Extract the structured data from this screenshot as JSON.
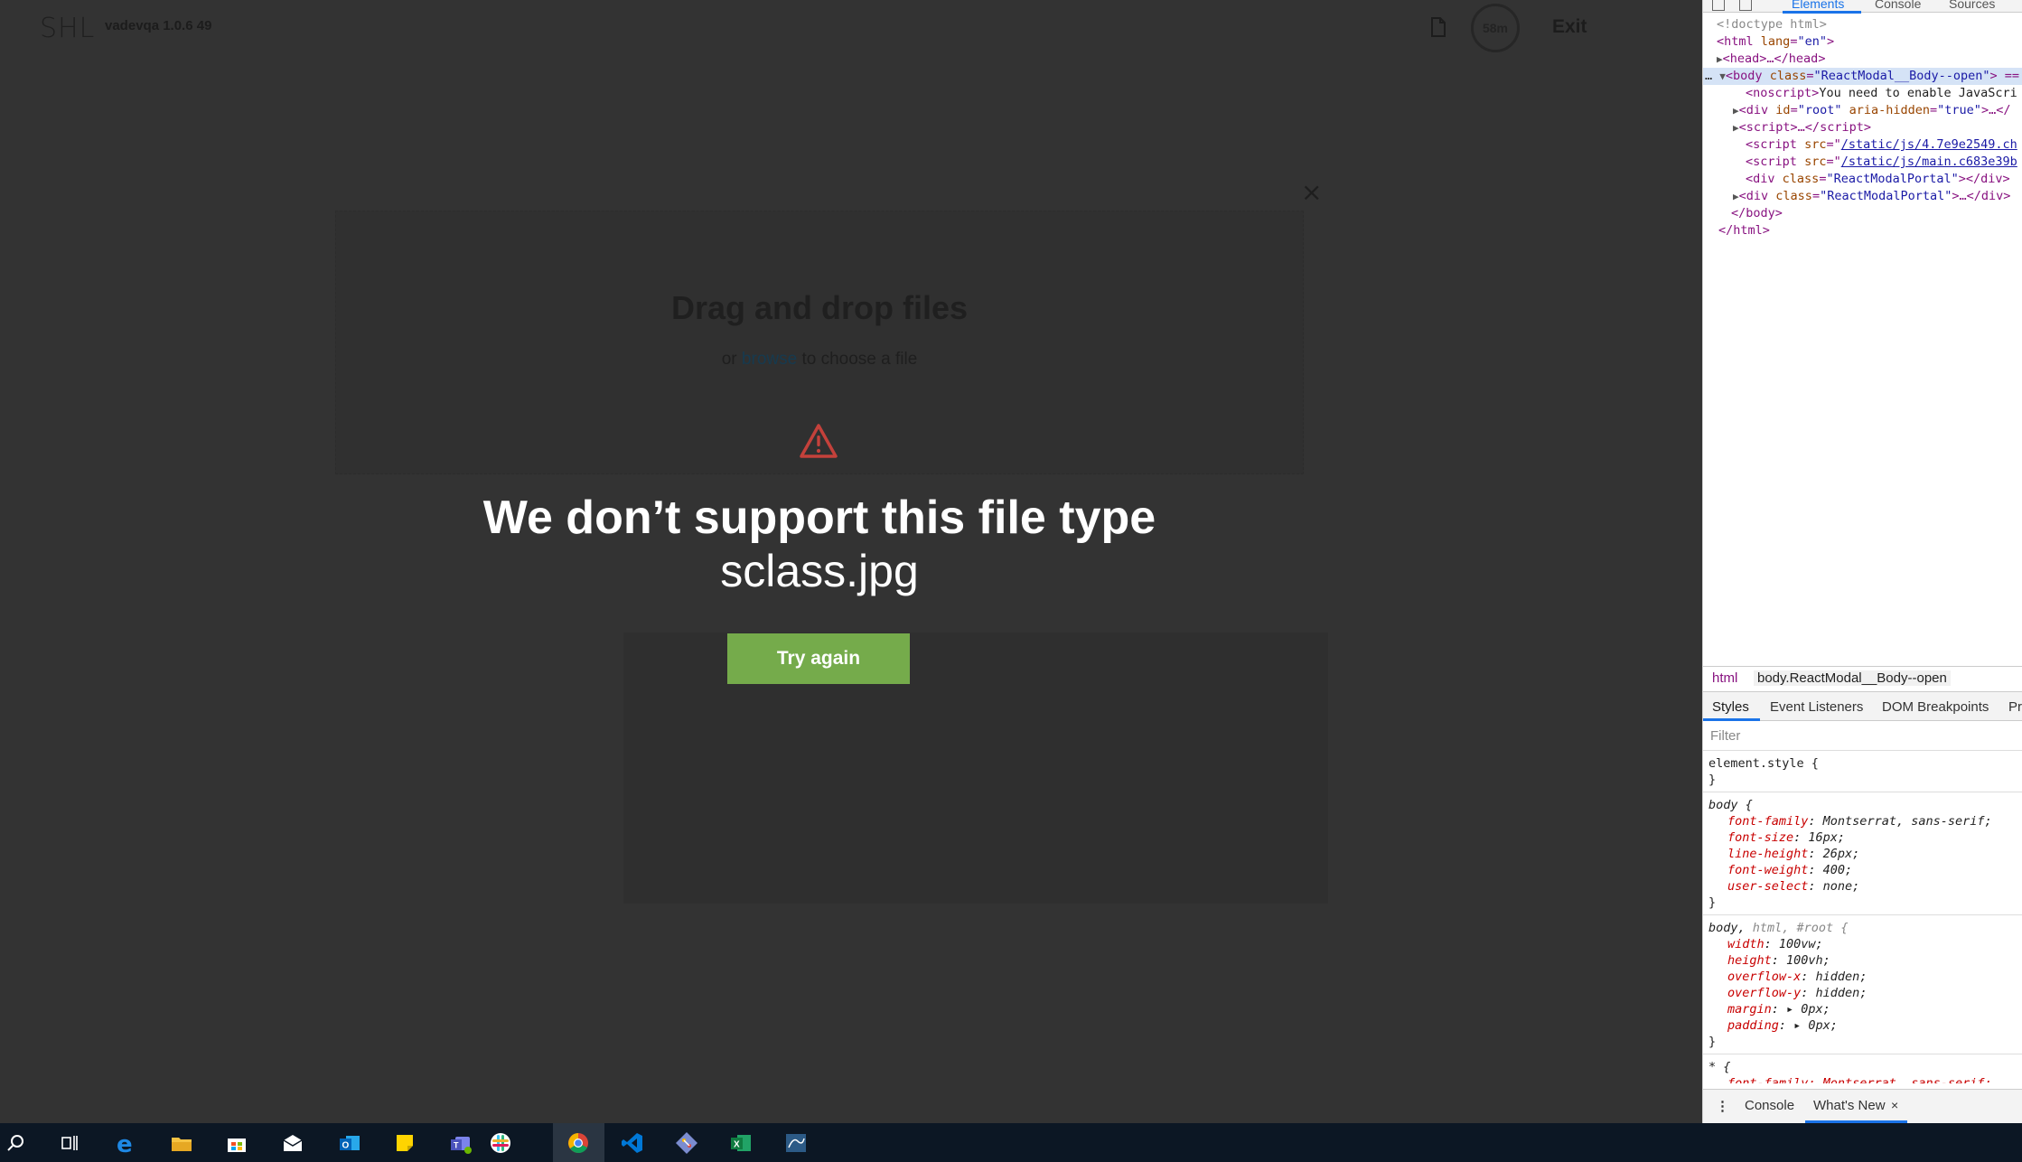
{
  "app": {
    "logo": "SHL",
    "version": "vadevqa 1.0.6 49",
    "timer": "58m",
    "exit_label": "Exit"
  },
  "modal": {
    "close_symbol": "×",
    "drag_title": "Drag and drop files",
    "browse_prefix": "or ",
    "browse_link": "browse",
    "browse_suffix": " to choose a file",
    "error_title": "We don’t support this file type",
    "error_file": "sclass.jpg",
    "try_again_label": "Try again",
    "accent_color": "#75ab4b",
    "warn_color": "#c4413b"
  },
  "devtools": {
    "tabs": [
      "Elements",
      "Console",
      "Sources"
    ],
    "dom": {
      "doctype": "<!doctype html>",
      "html_open_tag": "html",
      "html_lang_attr": "lang",
      "html_lang_val": "\"en\"",
      "head": "head",
      "head_collapsed": ">…</",
      "body_tag": "body",
      "body_class_attr": "class",
      "body_class_val": "\"ReactModal__Body--open\"",
      "body_suffix": "> ==",
      "noscript_tag": "noscript",
      "noscript_text": "You need to enable JavaScri",
      "root_div_tag": "div",
      "root_id_attr": "id",
      "root_id_val": "\"root\"",
      "root_aria_attr": "aria-hidden",
      "root_aria_val": "\"true\"",
      "root_collapsed": ">…</",
      "script_tag": "script",
      "script_collapsed": ">…</",
      "script_src_attr": "src",
      "script1_src": "/static/js/4.7e9e2549.ch",
      "script2_src": "/static/js/main.c683e39b",
      "portal_class_val": "\"ReactModalPortal\"",
      "body_close": "</body>",
      "html_close": "</html>"
    },
    "breadcrumbs": [
      "html",
      "body.ReactModal__Body--open"
    ],
    "subtabs": [
      "Styles",
      "Event Listeners",
      "DOM Breakpoints",
      "Pr"
    ],
    "filter_placeholder": "Filter",
    "styles": {
      "element_style": "element.style {",
      "close_brace": "}",
      "body_selector": "body {",
      "body_props": [
        {
          "prop": "font-family",
          "val": "Montserrat, sans-serif;"
        },
        {
          "prop": "font-size",
          "val": "16px;"
        },
        {
          "prop": "line-height",
          "val": "26px;"
        },
        {
          "prop": "font-weight",
          "val": "400;"
        },
        {
          "prop": "user-select",
          "val": "none;"
        }
      ],
      "root_selector_prefix": "body, ",
      "root_selector_rest": "html, #root {",
      "root_props": [
        {
          "prop": "width",
          "val": "100vw;"
        },
        {
          "prop": "height",
          "val": "100vh;"
        },
        {
          "prop": "overflow-x",
          "val": "hidden;"
        },
        {
          "prop": "overflow-y",
          "val": "hidden;"
        },
        {
          "prop": "margin",
          "val": "▸ 0px;"
        },
        {
          "prop": "padding",
          "val": "▸ 0px;"
        }
      ],
      "star_selector": "* {",
      "star_partial": "font-family: Montserrat, sans-serif;"
    },
    "drawer": {
      "menu_icon": "⋮",
      "console": "Console",
      "whats_new": "What's New",
      "close": "×"
    }
  },
  "taskbar": {
    "icons": [
      "search-icon",
      "task-view-icon",
      "edge-icon",
      "file-explorer-icon",
      "store-icon",
      "mail-icon",
      "outlook-icon",
      "sticky-notes-icon",
      "teams-icon",
      "slack-icon",
      "chrome-icon",
      "vscode-icon",
      "git-icon",
      "excel-icon",
      "mysql-workbench-icon"
    ]
  }
}
